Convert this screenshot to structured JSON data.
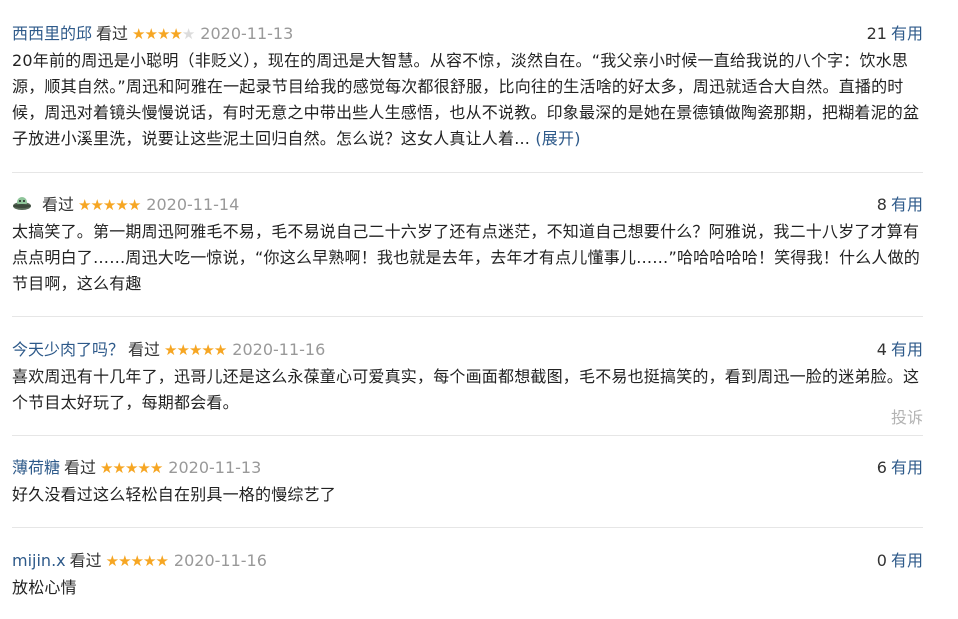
{
  "reviews": [
    {
      "user": "西西里的邱",
      "status": "看过",
      "rating": 4,
      "date": "2020-11-13",
      "votes": "21",
      "votes_label": "有用",
      "content": "20年前的周迅是小聪明（非贬义），现在的周迅是大智慧。从容不惊，淡然自在。“我父亲小时候一直给我说的八个字：饮水思源，顺其自然。”周迅和阿雅在一起录节目给我的感觉每次都很舒服，比向往的生活啥的好太多，周迅就适合大自然。直播的时候，周迅对着镜头慢慢说话，有时无意之中带出些人生感悟，也从不说教。印象最深的是她在景德镇做陶瓷那期，把糊着泥的盆子放进小溪里洗，说要让这些泥土回归自然。怎么说？这女人真让人着...",
      "expand_label": "(展开)"
    },
    {
      "user": "",
      "avatar_icon": "alien-ufo-icon",
      "status": "看过",
      "rating": 5,
      "date": "2020-11-14",
      "votes": "8",
      "votes_label": "有用",
      "content": "太搞笑了。第一期周迅阿雅毛不易，毛不易说自己二十六岁了还有点迷茫，不知道自己想要什么？阿雅说，我二十八岁了才算有点点明白了……周迅大吃一惊说，“你这么早熟啊！我也就是去年，去年才有点儿懂事儿……”哈哈哈哈哈！笑得我！什么人做的节目啊，这么有趣"
    },
    {
      "user": "今天少肉了吗？",
      "status": "看过",
      "rating": 5,
      "date": "2020-11-16",
      "votes": "4",
      "votes_label": "有用",
      "content": "喜欢周迅有十几年了，迅哥儿还是这么永葆童心可爱真实，每个画面都想截图，毛不易也挺搞笑的，看到周迅一脸的迷弟脸。这个节目太好玩了，每期都会看。",
      "report_label": "投诉"
    },
    {
      "user": "薄荷糖",
      "status": "看过",
      "rating": 5,
      "date": "2020-11-13",
      "votes": "6",
      "votes_label": "有用",
      "content": "好久没看过这么轻松自在别具一格的慢综艺了"
    },
    {
      "user": "mijin.x",
      "status": "看过",
      "rating": 5,
      "date": "2020-11-16",
      "votes": "0",
      "votes_label": "有用",
      "content": "放松心情"
    }
  ],
  "colors": {
    "link": "#2e5a8a",
    "star": "#f6a623",
    "date": "#999999",
    "report": "#b3b3b3"
  }
}
